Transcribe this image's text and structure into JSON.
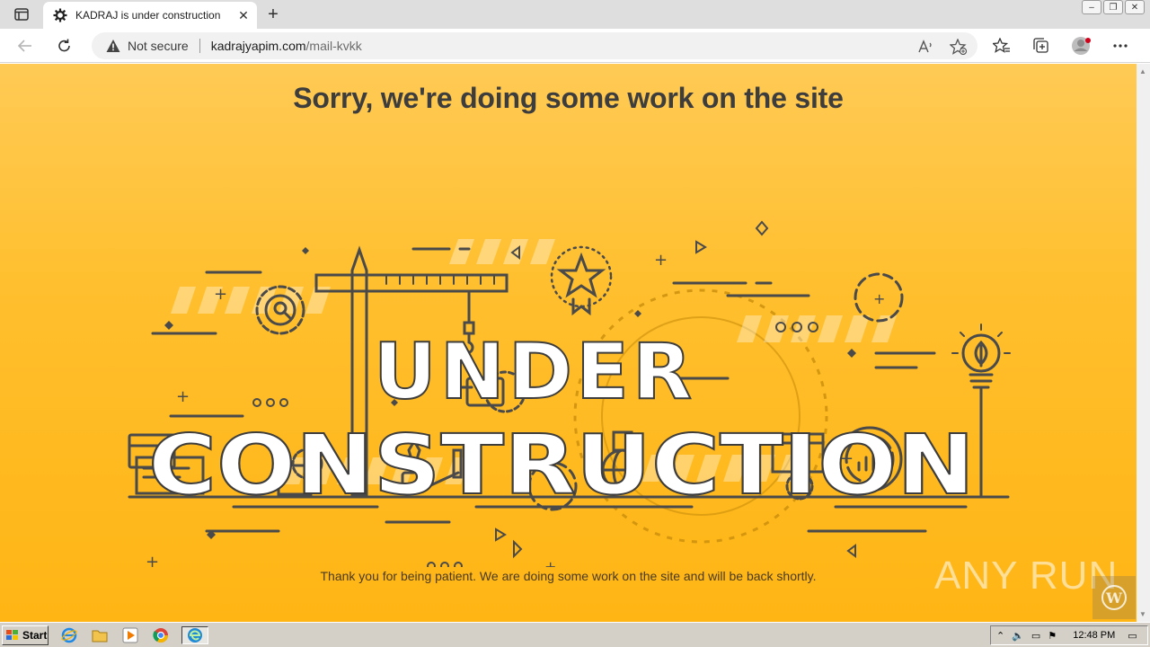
{
  "browser": {
    "tab": {
      "title": "KADRAJ is under construction",
      "close_glyph": "✕"
    },
    "new_tab_glyph": "+",
    "address": {
      "security_label": "Not secure",
      "domain": "kadrajyapim.com",
      "path": "/mail-kvkk"
    },
    "window_controls": [
      "–",
      "❐",
      "✕"
    ]
  },
  "page": {
    "headline": "Sorry, we're doing some work on the site",
    "illustration": {
      "line1": "UNDER",
      "line2": "CONSTRUCTION"
    },
    "message": "Thank you for being patient. We are doing some work on the site and will be back shortly.",
    "watermark": "ANY RUN"
  },
  "taskbar": {
    "start_label": "Start",
    "clock": "12:48 PM"
  },
  "colors": {
    "accent_bg": "#ffb514",
    "headline_text": "#3d3d3d",
    "line_art": "#4a4a4a"
  }
}
